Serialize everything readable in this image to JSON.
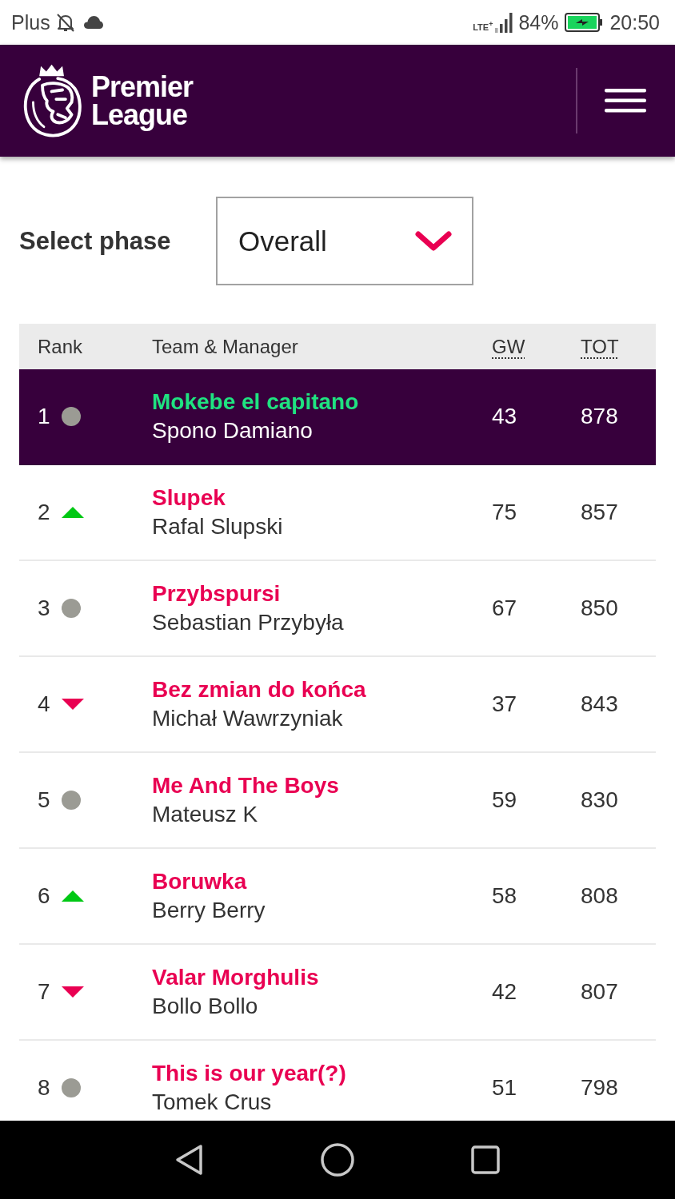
{
  "status_bar": {
    "carrier": "Plus",
    "network": "LTE$^{+}$",
    "battery": "84%",
    "time": "20:50"
  },
  "header": {
    "logo_text": "Premier League"
  },
  "phase_select": {
    "label": "Select phase",
    "value": "Overall"
  },
  "table": {
    "columns": [
      {
        "label": "Rank",
        "abbr": false
      },
      {
        "label": "Team & Manager",
        "abbr": false
      },
      {
        "label": "GW",
        "abbr": true
      },
      {
        "label": "TOT",
        "abbr": true
      }
    ],
    "rows": [
      {
        "rank": "1",
        "kind": "same",
        "team": "Mokebe el capitano",
        "manager": "Spono Damiano",
        "gw": "43",
        "tot": "878",
        "selected": true
      },
      {
        "rank": "2",
        "kind": "up",
        "team": "Slupek",
        "manager": "Rafal Slupski",
        "gw": "75",
        "tot": "857",
        "selected": false
      },
      {
        "rank": "3",
        "kind": "same",
        "team": "Przybspursi",
        "manager": "Sebastian Przybyła",
        "gw": "67",
        "tot": "850",
        "selected": false
      },
      {
        "rank": "4",
        "kind": "down",
        "team": "Bez zmian do końca",
        "manager": "Michał Wawrzyniak",
        "gw": "37",
        "tot": "843",
        "selected": false
      },
      {
        "rank": "5",
        "kind": "same",
        "team": "Me And The Boys",
        "manager": "Mateusz K",
        "gw": "59",
        "tot": "830",
        "selected": false
      },
      {
        "rank": "6",
        "kind": "up",
        "team": "Boruwka",
        "manager": "Berry Berry",
        "gw": "58",
        "tot": "808",
        "selected": false
      },
      {
        "rank": "7",
        "kind": "down",
        "team": "Valar Morghulis",
        "manager": "Bollo Bollo",
        "gw": "42",
        "tot": "807",
        "selected": false
      },
      {
        "rank": "8",
        "kind": "same",
        "team": "This is our year(?)",
        "manager": "Tomek Crus",
        "gw": "51",
        "tot": "798",
        "selected": false
      }
    ]
  }
}
